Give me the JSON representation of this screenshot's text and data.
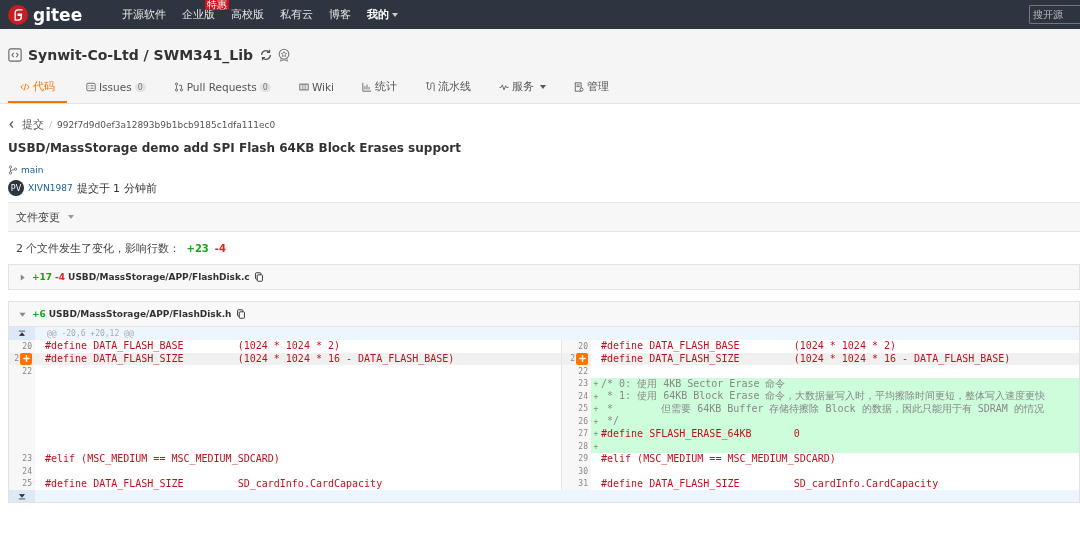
{
  "navbar": {
    "logo": "gitee",
    "items": [
      {
        "label": "开源软件"
      },
      {
        "label": "企业版",
        "badge": "特惠"
      },
      {
        "label": "高校版"
      },
      {
        "label": "私有云"
      },
      {
        "label": "博客"
      }
    ],
    "user_menu": "我的",
    "search": {
      "placeholder": "搜开源"
    }
  },
  "repo": {
    "title": "Synwit-Co-Ltd / SWM341_Lib"
  },
  "tabs": [
    {
      "label": "代码",
      "selected": true
    },
    {
      "label": "Issues",
      "count": "0",
      "selected": false
    },
    {
      "label": "Pull Requests",
      "count": "0",
      "selected": false
    },
    {
      "label": "Wiki",
      "selected": false
    },
    {
      "label": "统计",
      "selected": false
    },
    {
      "label": "流水线",
      "selected": false
    },
    {
      "label": "服务",
      "dropdown": true,
      "selected": false
    },
    {
      "label": "管理",
      "selected": false
    }
  ],
  "breadcrumb": {
    "back": "提交",
    "separator": "/",
    "hash": "992f7d9d0ef3a12893b9b1bcb9185c1dfa111ec0"
  },
  "commit": {
    "title": "USBD/MassStorage demo add SPI Flash 64KB Block Erases support",
    "branch": "main",
    "avatar": "PV",
    "author": "XIVN1987",
    "meta": "提交于 1 分钟前"
  },
  "changes": {
    "label": "文件变更",
    "summary": "2 个文件发生了变化，影响行数：",
    "additions": "+23",
    "deletions": "-4"
  },
  "files": [
    {
      "expanded": false,
      "additions": "+17",
      "deletions": "-4",
      "path": "USBD/MassStorage/APP/FlashDisk.c"
    },
    {
      "expanded": true,
      "additions": "+6",
      "path": "USBD/MassStorage/APP/FlashDisk.h"
    }
  ],
  "diff": {
    "hunk": "@@ -20,6 +20,12 @@",
    "rows": [
      {
        "added": false,
        "comment_button": false,
        "left": {
          "number": "20",
          "text": "#define DATA_FLASH_BASE         (1024 * 1024 * 2)",
          "kind": "code"
        },
        "right": {
          "number": "20",
          "text": "#define DATA_FLASH_BASE         (1024 * 1024 * 2)",
          "kind": "code"
        }
      },
      {
        "added": false,
        "comment_button": true,
        "left": {
          "number": "2",
          "text": "#define DATA_FLASH_SIZE         (1024 * 1024 * 16 - DATA_FLASH_BASE)",
          "kind": "code"
        },
        "right": {
          "number": "2",
          "text": "#define DATA_FLASH_SIZE         (1024 * 1024 * 16 - DATA_FLASH_BASE)",
          "kind": "code"
        }
      },
      {
        "added": false,
        "comment_button": false,
        "left": {
          "number": "22"
        },
        "right": {
          "number": "22"
        }
      },
      {
        "added": true,
        "comment_button": false,
        "right": {
          "number": "23",
          "marker": "+",
          "text": "/* 0: 使用 4KB Sector Erase 命令",
          "kind": "comment"
        }
      },
      {
        "added": true,
        "comment_button": false,
        "right": {
          "number": "24",
          "marker": "+",
          "text": " * 1: 使用 64KB Block Erase 命令，大数据量写入时，平均擦除时间更短，整体写入速度更快",
          "kind": "comment"
        }
      },
      {
        "added": true,
        "comment_button": false,
        "right": {
          "number": "25",
          "marker": "+",
          "text": " *        但需要 64KB Buffer 存储待擦除 Block 的数据，因此只能用于有 SDRAM 的情况",
          "kind": "comment"
        }
      },
      {
        "added": true,
        "comment_button": false,
        "right": {
          "number": "26",
          "marker": "+",
          "text": " */",
          "kind": "comment"
        }
      },
      {
        "added": true,
        "comment_button": false,
        "right": {
          "number": "27",
          "marker": "+",
          "text": "#define SFLASH_ERASE_64KB       0",
          "kind": "code"
        }
      },
      {
        "added": true,
        "comment_button": false,
        "right": {
          "number": "28",
          "marker": "+"
        }
      },
      {
        "added": false,
        "comment_button": false,
        "left": {
          "number": "23",
          "text": "#elif (MSC_MEDIUM == MSC_MEDIUM_SDCARD)",
          "kind": "code"
        },
        "right": {
          "number": "29",
          "text": "#elif (MSC_MEDIUM == MSC_MEDIUM_SDCARD)",
          "kind": "code"
        }
      },
      {
        "added": false,
        "comment_button": false,
        "left": {
          "number": "24"
        },
        "right": {
          "number": "30"
        }
      },
      {
        "added": false,
        "comment_button": false,
        "left": {
          "number": "25",
          "text": "#define DATA_FLASH_SIZE         SD_cardInfo.CardCapacity",
          "kind": "code"
        },
        "right": {
          "number": "31",
          "text": "#define DATA_FLASH_SIZE         SD_cardInfo.CardCapacity",
          "kind": "code"
        }
      }
    ]
  }
}
